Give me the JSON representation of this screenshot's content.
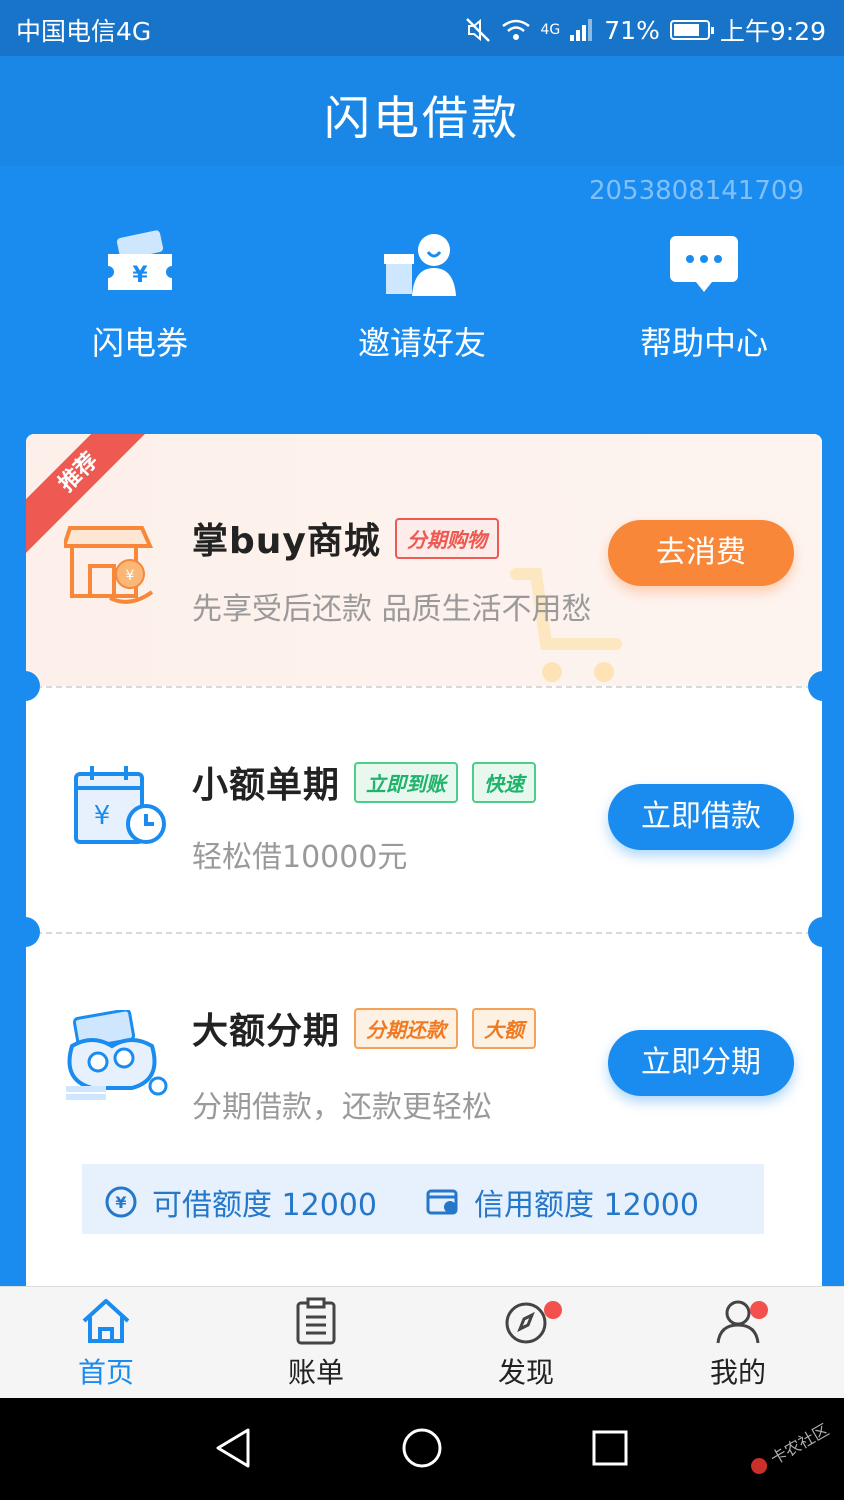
{
  "status_bar": {
    "carrier": "中国电信4G",
    "network": "4G",
    "battery": "71%",
    "time": "上午9:29"
  },
  "header": {
    "title": "闪电借款"
  },
  "account_id": "2053808141709",
  "quick_actions": [
    {
      "label": "闪电券",
      "icon": "coupon-icon"
    },
    {
      "label": "邀请好友",
      "icon": "invite-friend-icon"
    },
    {
      "label": "帮助中心",
      "icon": "help-chat-icon"
    }
  ],
  "products": [
    {
      "ribbon": "推荐",
      "title": "掌buy商城",
      "tags": [
        "分期购物"
      ],
      "subtitle": "先享受后还款 品质生活不用愁",
      "button": "去消费",
      "icon": "shop-icon"
    },
    {
      "title": "小额单期",
      "tags": [
        "立即到账",
        "快速"
      ],
      "subtitle": "轻松借10000元",
      "button": "立即借款",
      "icon": "calendar-clock-icon"
    },
    {
      "title": "大额分期",
      "tags": [
        "分期还款",
        "大额"
      ],
      "subtitle": "分期借款，还款更轻松",
      "button": "立即分期",
      "icon": "money-bag-icon"
    }
  ],
  "quota": {
    "available_label": "可借额度 12000",
    "credit_label": "信用额度 12000"
  },
  "tabbar": [
    {
      "label": "首页",
      "icon": "home-icon",
      "active": true
    },
    {
      "label": "账单",
      "icon": "bill-icon",
      "active": false
    },
    {
      "label": "发现",
      "icon": "compass-icon",
      "active": false,
      "badge": true
    },
    {
      "label": "我的",
      "icon": "user-icon",
      "active": false,
      "badge": true
    }
  ],
  "watermark": "卡农社区",
  "colors": {
    "primary": "#1a8cf0",
    "orange": "#f8873a",
    "red": "#ee5a52",
    "green": "#1fb36b"
  }
}
